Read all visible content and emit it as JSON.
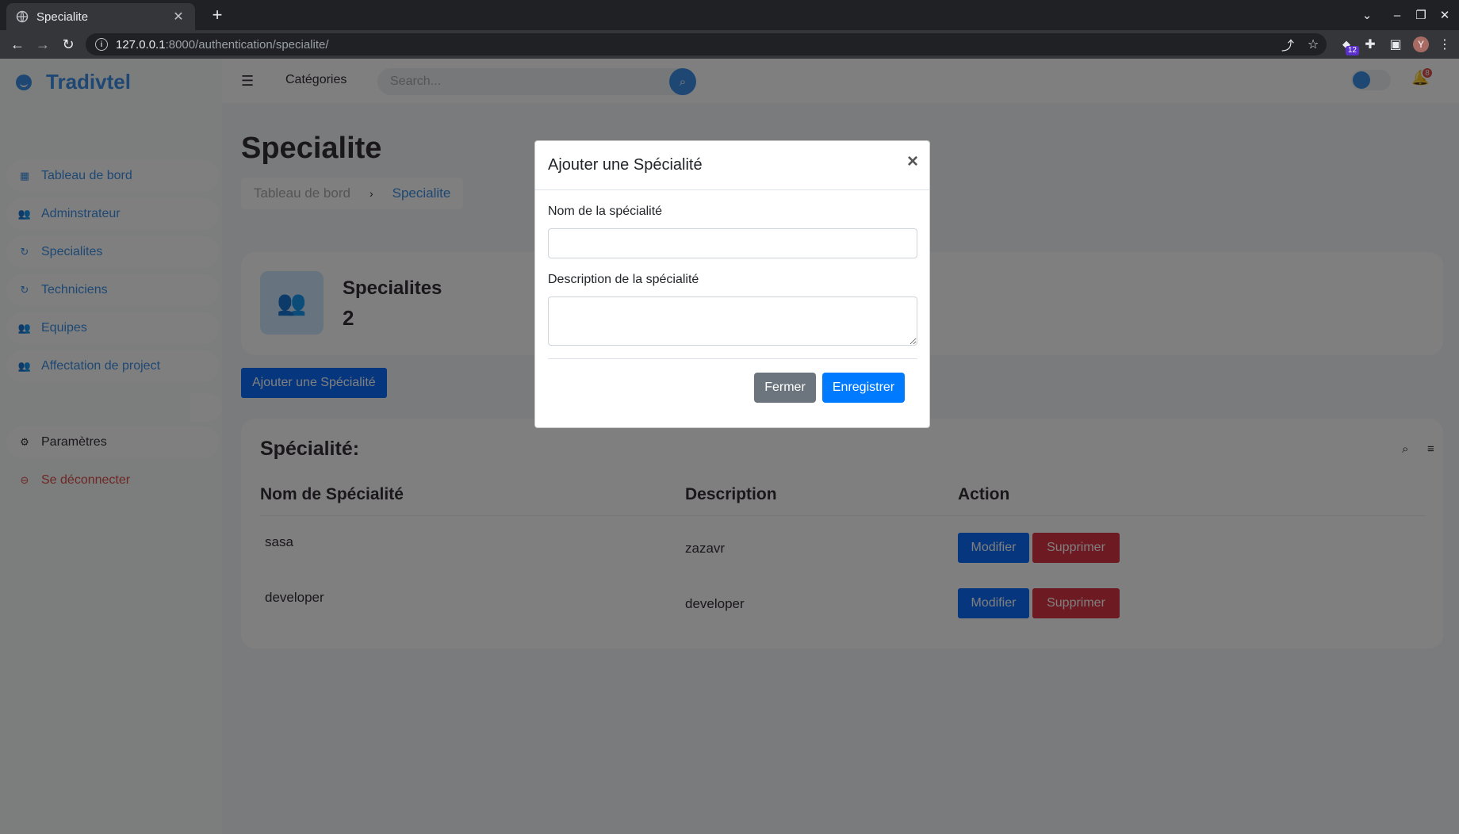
{
  "browser": {
    "tab_title": "Specialite",
    "url_host": "127.0.0.1",
    "url_path": ":8000/authentication/specialite/",
    "extension_badge": "12",
    "profile_initial": "Y"
  },
  "sidebar": {
    "brand": "Tradivtel",
    "items": [
      {
        "label": "Tableau de bord",
        "icon": "dashboard-icon"
      },
      {
        "label": "Adminstrateur",
        "icon": "users-icon"
      },
      {
        "label": "Specialites",
        "icon": "refresh-icon"
      },
      {
        "label": "Techniciens",
        "icon": "refresh-icon"
      },
      {
        "label": "Equipes",
        "icon": "users-icon"
      },
      {
        "label": "Affectation de project",
        "icon": "users-icon"
      }
    ],
    "settings_label": "Paramètres",
    "logout_label": "Se déconnecter"
  },
  "topnav": {
    "categories_label": "Catégories",
    "search_placeholder": "Search...",
    "notification_count": "8"
  },
  "page": {
    "title": "Specialite",
    "breadcrumb": {
      "home": "Tableau de bord",
      "separator": "›",
      "current": "Specialite"
    }
  },
  "stat": {
    "label": "Specialites",
    "value": "2"
  },
  "add_button_label": "Ajouter une Spécialité",
  "table": {
    "title": "Spécialité:",
    "headers": [
      "Nom de Spécialité",
      "Description",
      "Action"
    ],
    "rows": [
      {
        "name": "sasa",
        "description": "zazavr"
      },
      {
        "name": "developer",
        "description": "developer"
      }
    ],
    "edit_label": "Modifier",
    "delete_label": "Supprimer"
  },
  "modal": {
    "title": "Ajouter une Spécialité",
    "close_symbol": "×",
    "name_label": "Nom de la spécialité",
    "name_value": "",
    "description_label": "Description de la spécialité",
    "description_value": "",
    "close_button": "Fermer",
    "save_button": "Enregistrer"
  },
  "colors": {
    "accent": "#3c91e6",
    "primary_button": "#0d6efd",
    "danger": "#dc3545",
    "secondary": "#6c757d"
  }
}
